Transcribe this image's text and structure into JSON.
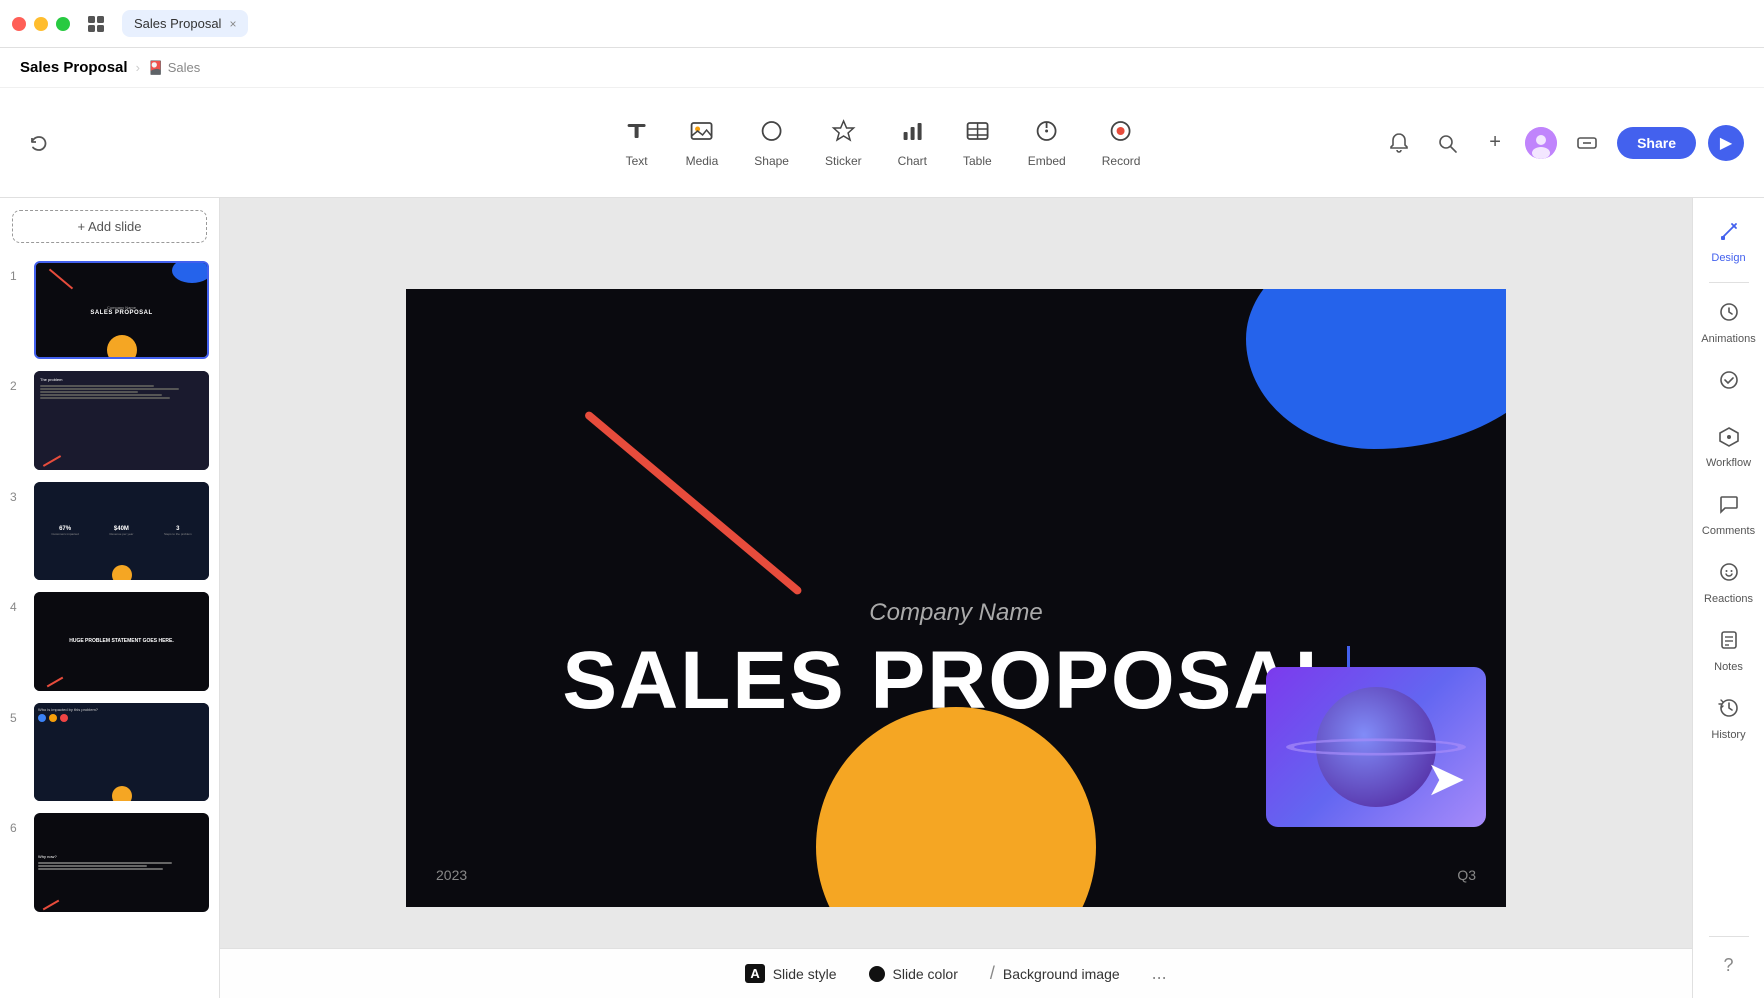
{
  "titlebar": {
    "doc_title": "Sales Proposal",
    "close_label": "×"
  },
  "breadcrumb": {
    "title": "Sales Proposal",
    "subtitle": "🎴 Sales"
  },
  "toolbar": {
    "undo_label": "↩",
    "items": [
      {
        "id": "text",
        "label": "Text",
        "icon": "T"
      },
      {
        "id": "media",
        "label": "Media",
        "icon": "◫"
      },
      {
        "id": "shape",
        "label": "Shape",
        "icon": "◯"
      },
      {
        "id": "sticker",
        "label": "Sticker",
        "icon": "★"
      },
      {
        "id": "chart",
        "label": "Chart",
        "icon": "📊"
      },
      {
        "id": "table",
        "label": "Table",
        "icon": "⊞"
      },
      {
        "id": "embed",
        "label": "Embed",
        "icon": "⊙"
      },
      {
        "id": "record",
        "label": "Record",
        "icon": "⊕"
      }
    ],
    "share_label": "Share",
    "play_label": "▶"
  },
  "slide_panel": {
    "add_slide_label": "+ Add slide",
    "slides": [
      {
        "num": 1,
        "active": true
      },
      {
        "num": 2,
        "active": false
      },
      {
        "num": 3,
        "active": false
      },
      {
        "num": 4,
        "active": false
      },
      {
        "num": 5,
        "active": false
      },
      {
        "num": 6,
        "active": false
      }
    ]
  },
  "canvas": {
    "company_name": "Company Name",
    "proposal_title": "SALES PROPOSAL",
    "year": "2023",
    "quarter": "Q3"
  },
  "bottom_bar": {
    "slide_style_label": "Slide style",
    "slide_color_label": "Slide color",
    "bg_image_label": "Background image",
    "more_label": "..."
  },
  "right_panel": {
    "items": [
      {
        "id": "design",
        "label": "Design",
        "icon": "✂"
      },
      {
        "id": "animations",
        "label": "Animations",
        "icon": "⟳"
      },
      {
        "id": "check",
        "label": "",
        "icon": "✓"
      },
      {
        "id": "workflow",
        "label": "Workflow",
        "icon": "⬡"
      },
      {
        "id": "comments",
        "label": "Comments",
        "icon": "💬"
      },
      {
        "id": "reactions",
        "label": "Reactions",
        "icon": "😊"
      },
      {
        "id": "notes",
        "label": "Notes",
        "icon": "📝"
      },
      {
        "id": "history",
        "label": "History",
        "icon": "🕐"
      }
    ],
    "help_icon": "?"
  }
}
